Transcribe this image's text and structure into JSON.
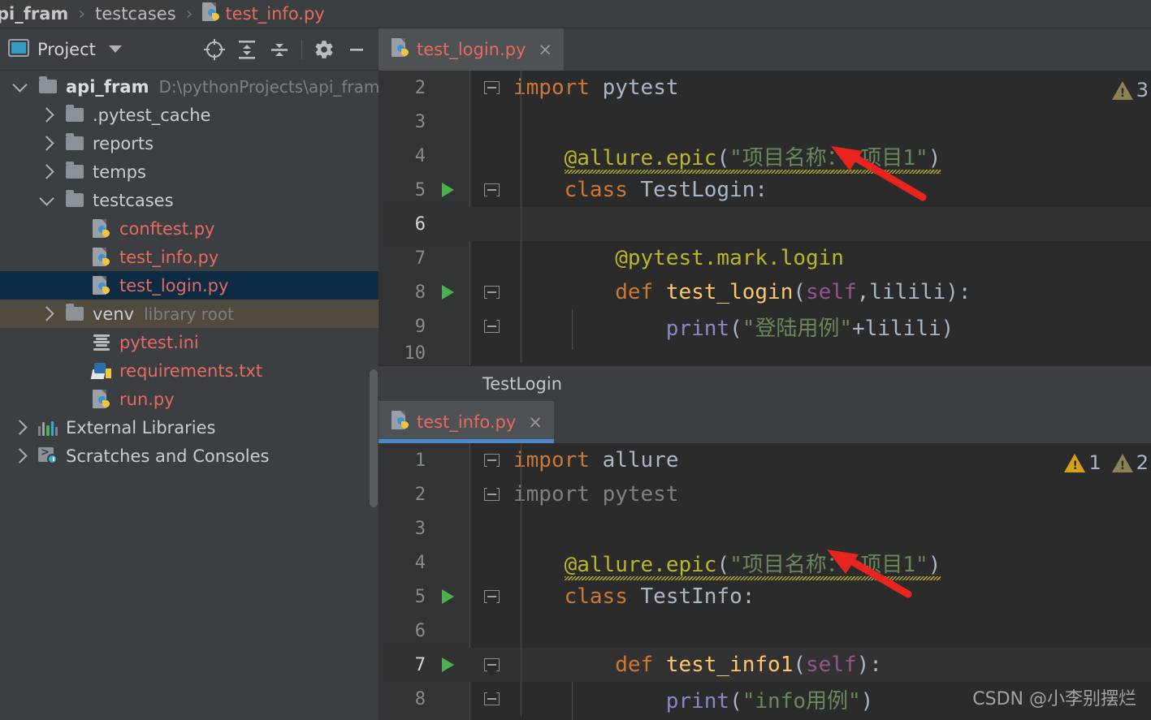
{
  "breadcrumb": {
    "items": [
      {
        "label": "pi_fram",
        "type": "project",
        "bold": true
      },
      {
        "label": "testcases",
        "type": "folder",
        "bold": false
      },
      {
        "label": "test_info.py",
        "type": "pyfile",
        "bold": false
      }
    ],
    "separator": "›"
  },
  "project_panel": {
    "title": "Project",
    "caret_icon": "chevron-down-icon",
    "tools": [
      {
        "name": "locate-icon",
        "tooltip": "Select Opened File"
      },
      {
        "name": "expand-all-icon",
        "tooltip": "Expand All"
      },
      {
        "name": "collapse-all-icon",
        "tooltip": "Collapse All"
      },
      {
        "name": "gear-icon",
        "tooltip": "Settings"
      },
      {
        "name": "minimize-icon",
        "tooltip": "Hide"
      }
    ],
    "tree": [
      {
        "label": "api_fram",
        "sub": "D:\\pythonProjects\\api_fram",
        "icon": "folder-icon",
        "indent": 0,
        "expanded": true,
        "bold": true,
        "kind": "folder",
        "state": "normal"
      },
      {
        "label": ".pytest_cache",
        "sub": "",
        "icon": "folder-icon",
        "indent": 1,
        "expanded": false,
        "bold": false,
        "kind": "folder",
        "state": "normal"
      },
      {
        "label": "reports",
        "sub": "",
        "icon": "folder-icon",
        "indent": 1,
        "expanded": false,
        "bold": false,
        "kind": "folder",
        "state": "normal"
      },
      {
        "label": "temps",
        "sub": "",
        "icon": "folder-icon",
        "indent": 1,
        "expanded": false,
        "bold": false,
        "kind": "folder",
        "state": "normal"
      },
      {
        "label": "testcases",
        "sub": "",
        "icon": "folder-icon",
        "indent": 1,
        "expanded": true,
        "bold": false,
        "kind": "folder",
        "state": "normal"
      },
      {
        "label": "conftest.py",
        "sub": "",
        "icon": "python-file-icon",
        "indent": 2,
        "expanded": null,
        "bold": false,
        "kind": "py",
        "state": "normal"
      },
      {
        "label": "test_info.py",
        "sub": "",
        "icon": "python-file-icon",
        "indent": 2,
        "expanded": null,
        "bold": false,
        "kind": "py",
        "state": "normal"
      },
      {
        "label": "test_login.py",
        "sub": "",
        "icon": "python-file-icon",
        "indent": 2,
        "expanded": null,
        "bold": false,
        "kind": "py",
        "state": "selected"
      },
      {
        "label": "venv",
        "sub": "library root",
        "icon": "folder-icon",
        "indent": 1,
        "expanded": false,
        "bold": false,
        "kind": "folder",
        "state": "libroot"
      },
      {
        "label": "pytest.ini",
        "sub": "",
        "icon": "ini-file-icon",
        "indent": 2,
        "expanded": null,
        "bold": false,
        "kind": "ini",
        "state": "normal"
      },
      {
        "label": "requirements.txt",
        "sub": "",
        "icon": "package-icon",
        "indent": 2,
        "expanded": null,
        "bold": false,
        "kind": "txt",
        "state": "normal"
      },
      {
        "label": "run.py",
        "sub": "",
        "icon": "python-file-icon",
        "indent": 2,
        "expanded": null,
        "bold": false,
        "kind": "py",
        "state": "normal"
      },
      {
        "label": "External Libraries",
        "sub": "",
        "icon": "external-libraries-icon",
        "indent": 0,
        "expanded": false,
        "bold": false,
        "kind": "lib",
        "state": "normal"
      },
      {
        "label": "Scratches and Consoles",
        "sub": "",
        "icon": "scratches-icon",
        "indent": 0,
        "expanded": false,
        "bold": false,
        "kind": "scratch",
        "state": "normal"
      }
    ]
  },
  "editors": [
    {
      "tab": {
        "label": "test_login.py",
        "close": "×",
        "active": false,
        "icon": "python-file-icon"
      },
      "warnings": [
        {
          "count": "3",
          "severity": "olive"
        }
      ],
      "breadcrumb": "TestLogin",
      "lines": [
        {
          "num": "2",
          "run": false,
          "fold": "tipdown",
          "caret": false,
          "tokens": [
            {
              "t": "import ",
              "c": "kw"
            },
            {
              "t": "pytest",
              "c": "id"
            }
          ]
        },
        {
          "num": "3",
          "run": false,
          "fold": "",
          "caret": false,
          "tokens": []
        },
        {
          "num": "4",
          "run": false,
          "fold": "",
          "caret": false,
          "squiggle": true,
          "indent": 1,
          "tokens": [
            {
              "t": "@allure.epic",
              "c": "dec"
            },
            {
              "t": "(",
              "c": "punc"
            },
            {
              "t": "\"项目名称： 项目1\"",
              "c": "str"
            },
            {
              "t": ")",
              "c": "punc"
            }
          ]
        },
        {
          "num": "5",
          "run": true,
          "fold": "tipdown",
          "caret": false,
          "indent": 1,
          "tokens": [
            {
              "t": "class ",
              "c": "kw"
            },
            {
              "t": "TestLogin",
              "c": "id"
            },
            {
              "t": ":",
              "c": "punc"
            }
          ]
        },
        {
          "num": "6",
          "run": false,
          "fold": "",
          "caret": true,
          "tokens": []
        },
        {
          "num": "7",
          "run": false,
          "fold": "",
          "caret": false,
          "indent": 2,
          "tokens": [
            {
              "t": "@pytest.mark.login",
              "c": "dec"
            }
          ]
        },
        {
          "num": "8",
          "run": true,
          "fold": "tipdown",
          "caret": false,
          "indent": 2,
          "tokens": [
            {
              "t": "def ",
              "c": "kw"
            },
            {
              "t": "test_login",
              "c": "fn"
            },
            {
              "t": "(",
              "c": "punc"
            },
            {
              "t": "self",
              "c": "self"
            },
            {
              "t": ",",
              "c": "punc"
            },
            {
              "t": "lilili",
              "c": "id"
            },
            {
              "t": ")",
              "c": "punc"
            },
            {
              "t": ":",
              "c": "punc"
            }
          ]
        },
        {
          "num": "9",
          "run": false,
          "fold": "tipup",
          "caret": false,
          "indent": 3,
          "tokens": [
            {
              "t": "print",
              "c": "call"
            },
            {
              "t": "(",
              "c": "punc"
            },
            {
              "t": "\"登陆用例\"",
              "c": "str"
            },
            {
              "t": "+",
              "c": "punc"
            },
            {
              "t": "lilili",
              "c": "id"
            },
            {
              "t": ")",
              "c": "punc"
            }
          ]
        },
        {
          "num": "10",
          "run": false,
          "fold": "",
          "caret": false,
          "clipped": true,
          "tokens": []
        }
      ]
    },
    {
      "tab": {
        "label": "test_info.py",
        "close": "×",
        "active": true,
        "icon": "python-file-icon"
      },
      "warnings": [
        {
          "count": "1",
          "severity": "yellow"
        },
        {
          "count": "2",
          "severity": "olive"
        }
      ],
      "breadcrumb": "",
      "lines": [
        {
          "num": "1",
          "run": false,
          "fold": "tipdown",
          "caret": false,
          "tokens": [
            {
              "t": "import ",
              "c": "kw"
            },
            {
              "t": "allure",
              "c": "id"
            }
          ]
        },
        {
          "num": "2",
          "run": false,
          "fold": "tipup",
          "caret": false,
          "tokens": [
            {
              "t": "import pytest",
              "c": "gray"
            }
          ]
        },
        {
          "num": "3",
          "run": false,
          "fold": "",
          "caret": false,
          "tokens": []
        },
        {
          "num": "4",
          "run": false,
          "fold": "",
          "caret": false,
          "squiggle": true,
          "indent": 1,
          "tokens": [
            {
              "t": "@allure.epic",
              "c": "dec"
            },
            {
              "t": "(",
              "c": "punc"
            },
            {
              "t": "\"项目名称： 项目1\"",
              "c": "str"
            },
            {
              "t": ")",
              "c": "punc"
            }
          ]
        },
        {
          "num": "5",
          "run": true,
          "fold": "tipdown",
          "caret": false,
          "indent": 1,
          "tokens": [
            {
              "t": "class ",
              "c": "kw"
            },
            {
              "t": "TestInfo",
              "c": "id"
            },
            {
              "t": ":",
              "c": "punc"
            }
          ]
        },
        {
          "num": "6",
          "run": false,
          "fold": "",
          "caret": false,
          "tokens": []
        },
        {
          "num": "7",
          "run": true,
          "fold": "tipdown",
          "caret": true,
          "indent": 2,
          "tokens": [
            {
              "t": "def ",
              "c": "kw"
            },
            {
              "t": "test_info1",
              "c": "fn"
            },
            {
              "t": "(",
              "c": "punc"
            },
            {
              "t": "self",
              "c": "self"
            },
            {
              "t": ")",
              "c": "punc"
            },
            {
              "t": ":",
              "c": "punc"
            }
          ]
        },
        {
          "num": "8",
          "run": false,
          "fold": "tipup",
          "caret": false,
          "indent": 3,
          "tokens": [
            {
              "t": "print",
              "c": "call"
            },
            {
              "t": "(",
              "c": "punc"
            },
            {
              "t": "\"info用例\"",
              "c": "str"
            },
            {
              "t": ")",
              "c": "punc"
            }
          ]
        }
      ]
    }
  ],
  "annotations": {
    "arrows": [
      {
        "name": "arrow-pointing-allure-epic-login",
        "color": "#e8241f"
      },
      {
        "name": "arrow-pointing-allure-epic-info",
        "color": "#e8241f"
      }
    ]
  },
  "watermark": "CSDN @小李别摆烂",
  "colors": {
    "panel_bg": "#3c3f41",
    "editor_bg": "#2b2b2b",
    "gutter_bg": "#313335",
    "selection": "#0d2b42",
    "library_root": "#514a3f",
    "accent_blue": "#4a88c7",
    "py_red": "#e8695f",
    "keyword": "#cc7832",
    "string": "#6a8759",
    "decorator": "#bbb529",
    "function": "#ffc66d",
    "self": "#94558d",
    "annotation_red": "#e8241f"
  }
}
